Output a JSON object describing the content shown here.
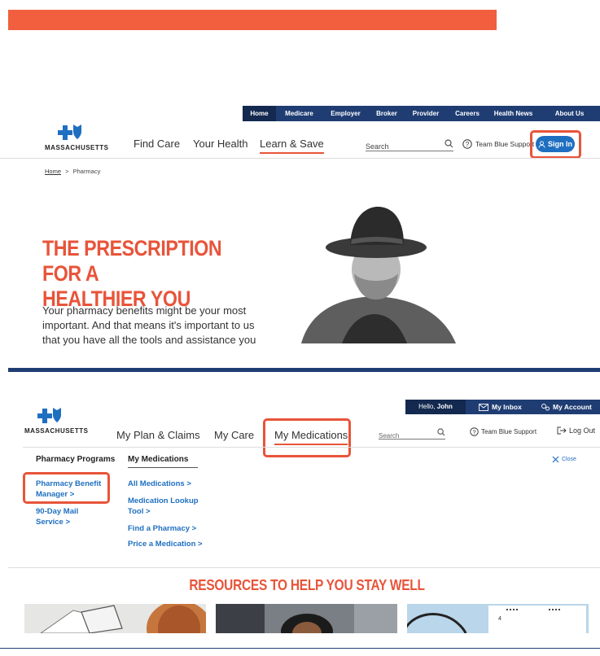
{
  "screen1": {
    "utility_nav": [
      "Home",
      "Medicare",
      "Employer",
      "Broker",
      "Provider",
      "Careers",
      "Health News",
      "About Us"
    ],
    "logo_text": "MASSACHUSETTS",
    "main_nav": [
      "Find Care",
      "Your Health",
      "Learn & Save"
    ],
    "search_placeholder": "Search",
    "support_label": "Team Blue Support",
    "sign_in_label": "Sign In",
    "breadcrumb": {
      "home": "Home",
      "separator": ">",
      "current": "Pharmacy"
    },
    "headline_line1": "THE PRESCRIPTION FOR A",
    "headline_line2": "HEALTHIER YOU",
    "paragraph_lines": [
      "Your pharmacy benefits might be your most",
      "important. And that means it's important to us",
      "that you have all the tools and assistance you"
    ]
  },
  "screen2": {
    "greeting_prefix": "Hello,",
    "greeting_name": "John",
    "inbox_label": "My Inbox",
    "account_label": "My Account",
    "logo_text": "MASSACHUSETTS",
    "main_nav": [
      "My Plan & Claims",
      "My Care",
      "My Medications"
    ],
    "search_placeholder": "Search",
    "support_label": "Team Blue Support",
    "logout_label": "Log Out",
    "menu": {
      "col1_title": "Pharmacy Programs",
      "col1_links": [
        "Pharmacy Benefit",
        "Manager >",
        "90-Day Mail",
        "Service >"
      ],
      "col2_title": "My Medications",
      "col2_links": [
        "All Medications >",
        "Medication Lookup",
        "Tool >",
        "Find a Pharmacy >",
        "Price a Medication >"
      ],
      "close_label": "Close"
    },
    "resources_heading": "RESOURCES TO HELP YOU STAY WELL"
  },
  "colors": {
    "accent_orange": "#e8543a",
    "brand_navy": "#1f3d73",
    "link_blue": "#1f6fc1"
  }
}
